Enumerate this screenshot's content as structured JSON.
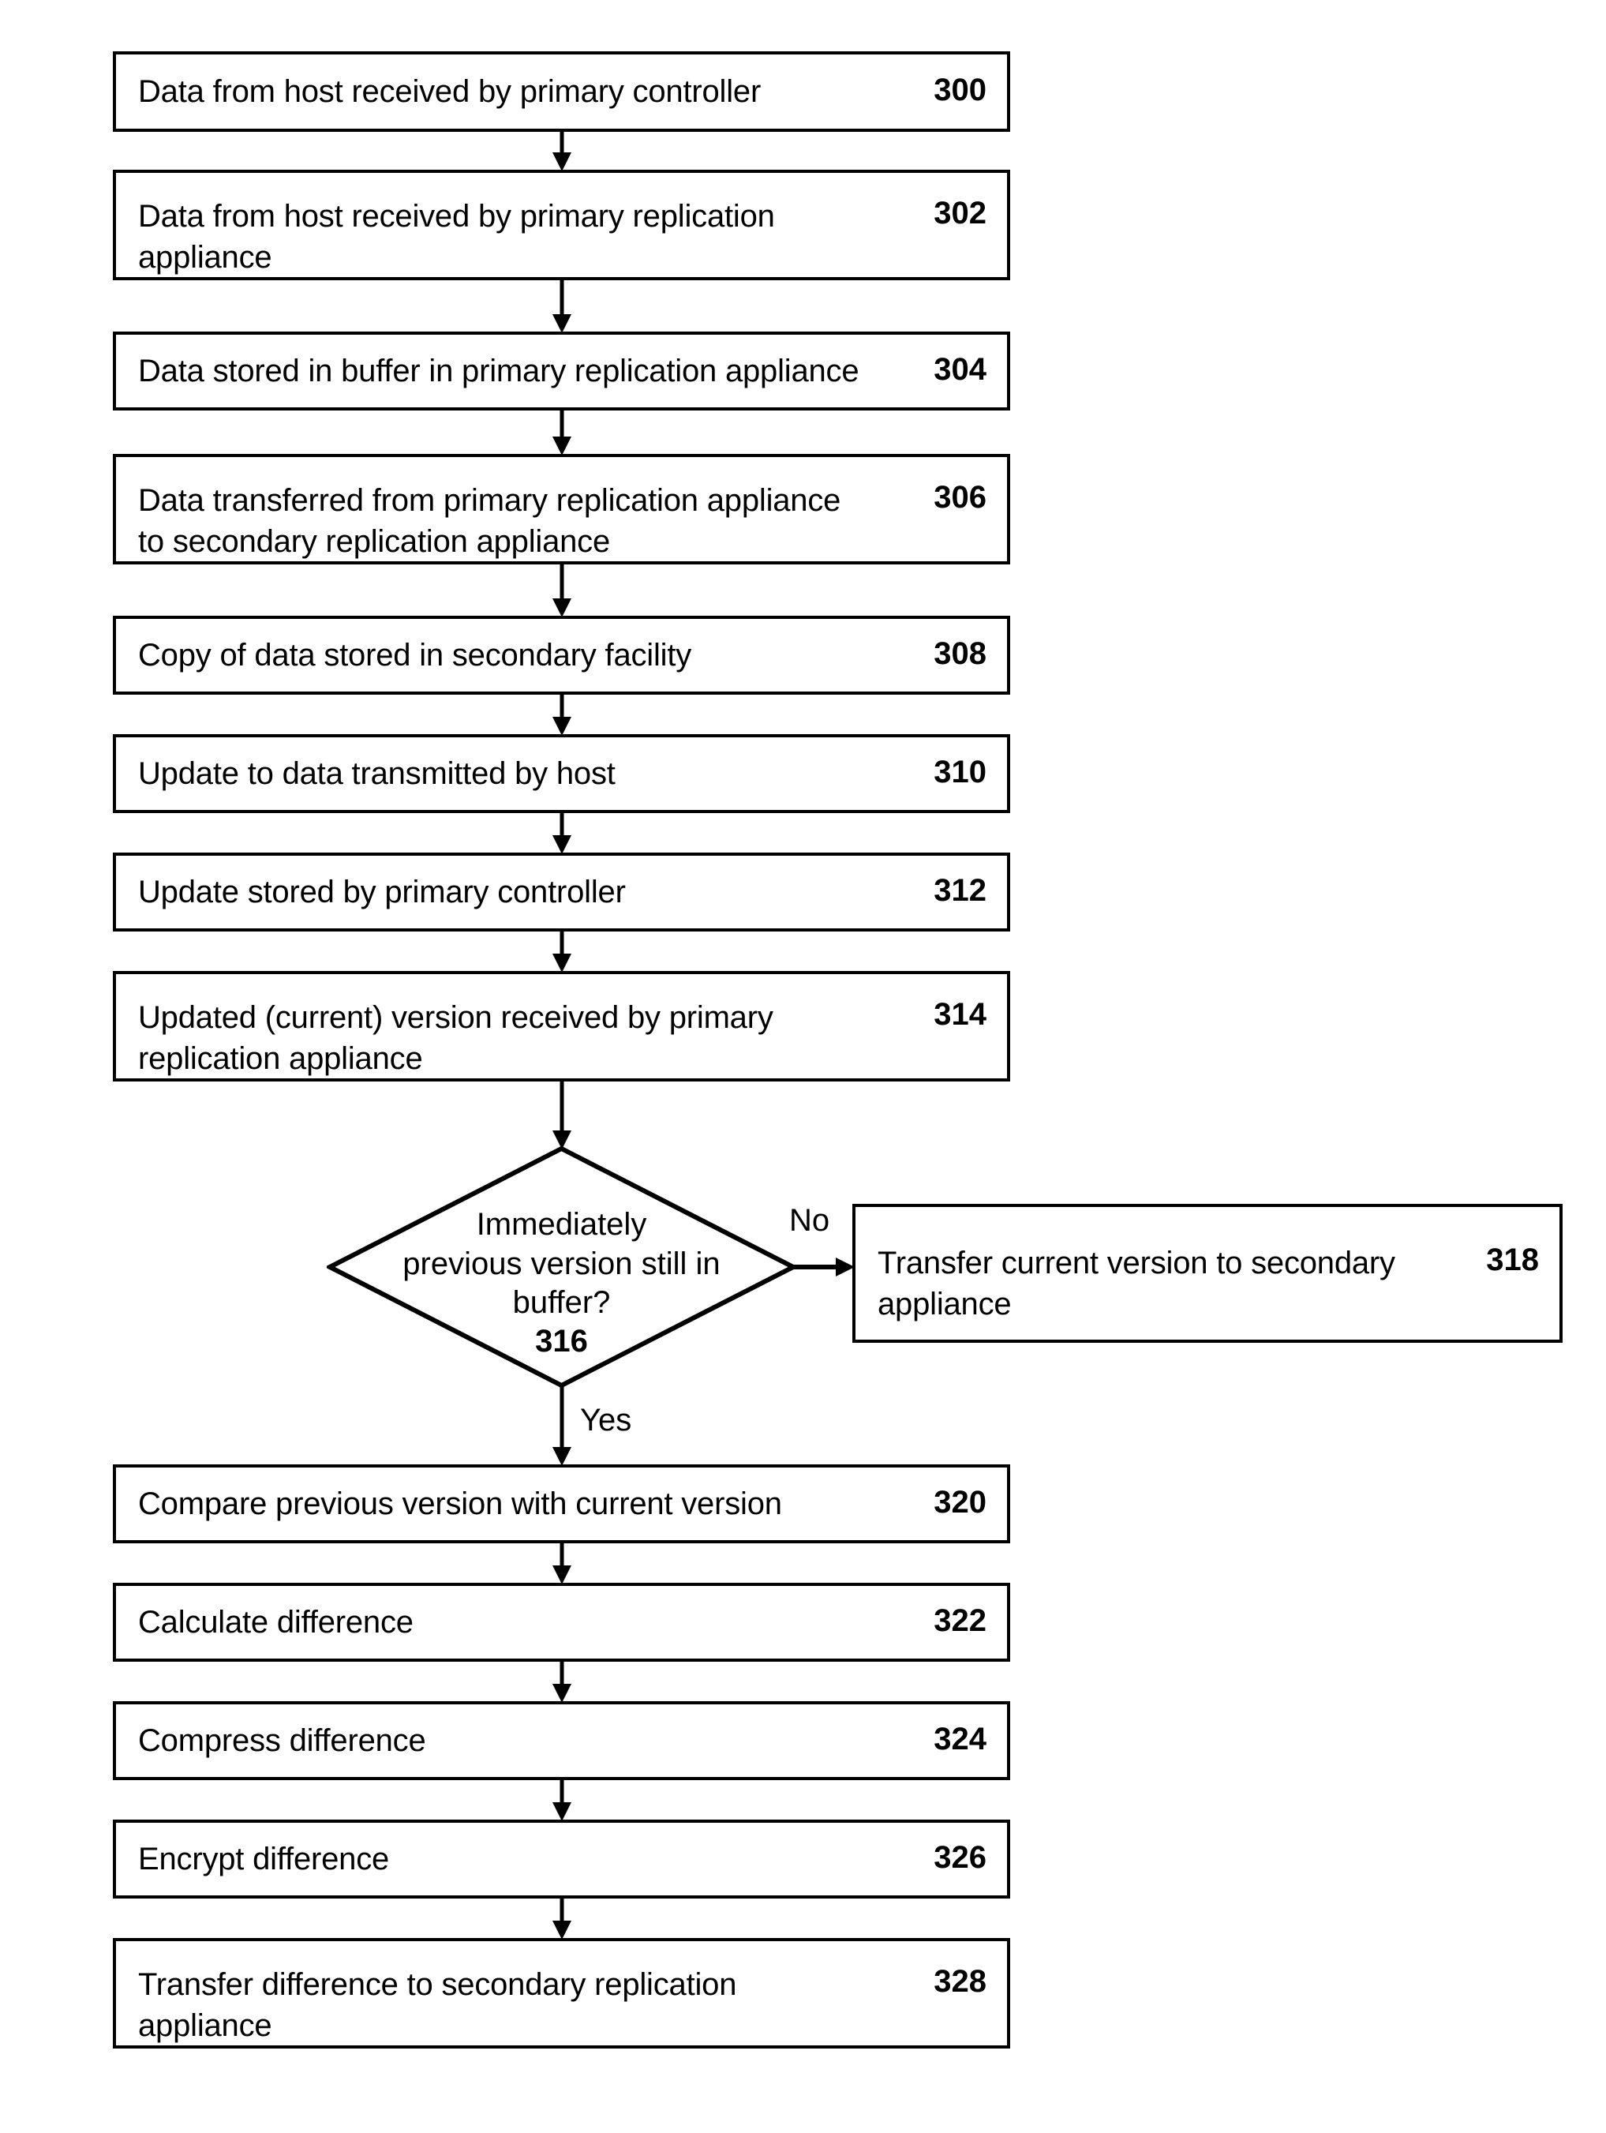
{
  "figure": {
    "type": "flowchart",
    "orientation": "vertical",
    "background_color": "#ffffff",
    "line_color": "#000000",
    "text_color": "#000000"
  },
  "nodes": [
    {
      "id": "n300",
      "shape": "process",
      "text": "Data from host received by primary controller",
      "ref": "300"
    },
    {
      "id": "n302",
      "shape": "process",
      "text": "Data from host received by primary replication\nappliance",
      "ref": "302"
    },
    {
      "id": "n304",
      "shape": "process",
      "text": "Data stored in buffer in primary replication appliance",
      "ref": "304"
    },
    {
      "id": "n306",
      "shape": "process",
      "text": "Data transferred from primary replication appliance\nto secondary replication appliance",
      "ref": "306"
    },
    {
      "id": "n308",
      "shape": "process",
      "text": "Copy of data stored in secondary facility",
      "ref": "308"
    },
    {
      "id": "n310",
      "shape": "process",
      "text": "Update to data transmitted by host",
      "ref": "310"
    },
    {
      "id": "n312",
      "shape": "process",
      "text": "Update stored by primary controller",
      "ref": "312"
    },
    {
      "id": "n314",
      "shape": "process",
      "text": "Updated (current) version received by primary\nreplication appliance",
      "ref": "314"
    },
    {
      "id": "n316",
      "shape": "decision",
      "text": "Immediately\nprevious version still in\nbuffer?",
      "ref": "316"
    },
    {
      "id": "n318",
      "shape": "process",
      "text": "Transfer current version to secondary\nappliance",
      "ref": "318"
    },
    {
      "id": "n320",
      "shape": "process",
      "text": "Compare previous version with current version",
      "ref": "320"
    },
    {
      "id": "n322",
      "shape": "process",
      "text": "Calculate difference",
      "ref": "322"
    },
    {
      "id": "n324",
      "shape": "process",
      "text": "Compress difference",
      "ref": "324"
    },
    {
      "id": "n326",
      "shape": "process",
      "text": "Encrypt difference",
      "ref": "326"
    },
    {
      "id": "n328",
      "shape": "process",
      "text": "Transfer difference to secondary replication\nappliance",
      "ref": "328"
    }
  ],
  "edges": [
    {
      "id": "e1",
      "from": "n300",
      "to": "n302",
      "label": ""
    },
    {
      "id": "e2",
      "from": "n302",
      "to": "n304",
      "label": ""
    },
    {
      "id": "e3",
      "from": "n304",
      "to": "n306",
      "label": ""
    },
    {
      "id": "e4",
      "from": "n306",
      "to": "n308",
      "label": ""
    },
    {
      "id": "e5",
      "from": "n308",
      "to": "n310",
      "label": ""
    },
    {
      "id": "e6",
      "from": "n310",
      "to": "n312",
      "label": ""
    },
    {
      "id": "e7",
      "from": "n312",
      "to": "n314",
      "label": ""
    },
    {
      "id": "e8",
      "from": "n314",
      "to": "n316",
      "label": ""
    },
    {
      "id": "e9",
      "from": "n316",
      "to": "n318",
      "label": "No"
    },
    {
      "id": "e10",
      "from": "n316",
      "to": "n320",
      "label": "Yes"
    },
    {
      "id": "e11",
      "from": "n320",
      "to": "n322",
      "label": ""
    },
    {
      "id": "e12",
      "from": "n322",
      "to": "n324",
      "label": ""
    },
    {
      "id": "e13",
      "from": "n324",
      "to": "n326",
      "label": ""
    },
    {
      "id": "e14",
      "from": "n326",
      "to": "n328",
      "label": ""
    }
  ],
  "branch_labels": {
    "no": "No",
    "yes": "Yes"
  }
}
